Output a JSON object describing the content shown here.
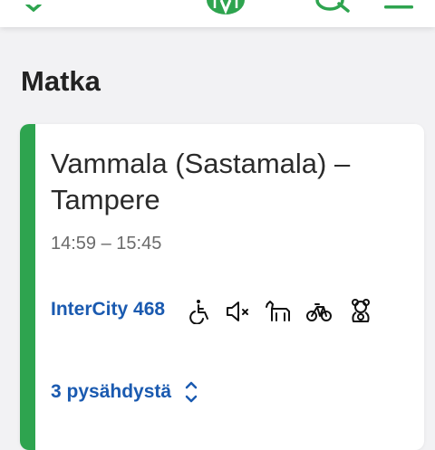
{
  "header": {
    "logo_icon": "hsl-logo-icon",
    "search_icon": "search-icon",
    "menu_icon": "menu-icon",
    "colors": {
      "brand": "#2ea44f"
    }
  },
  "page": {
    "title": "Matka"
  },
  "trip": {
    "route": "Vammala (Sastamala) – Tampere",
    "time": "14:59 – 15:45",
    "train": "InterCity 468",
    "amenities": [
      "wheelchair-icon",
      "quiet-zone-icon",
      "pet-icon",
      "bicycle-icon",
      "teddy-bear-icon"
    ],
    "stops_label": "3 pysähdystä",
    "stops_icon": "chevron-up-down-icon",
    "colors": {
      "accent": "#2ea44f",
      "link": "#1a5ab0"
    }
  }
}
